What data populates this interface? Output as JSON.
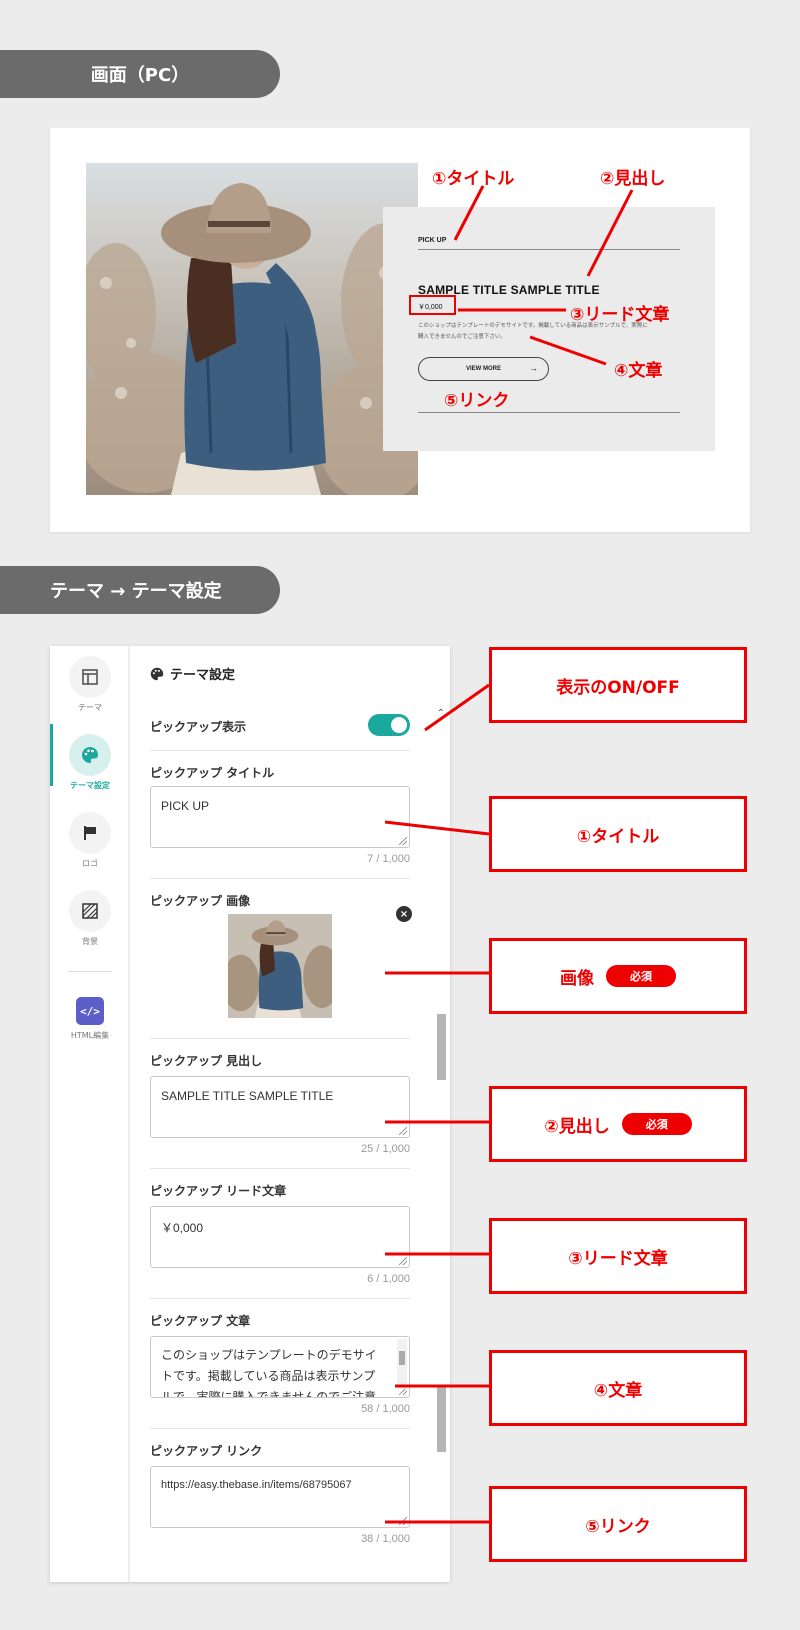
{
  "sections": {
    "pc_title": "画面（PC）",
    "settings_title": "テーマ → テーマ設定"
  },
  "pc_preview": {
    "pickup_title": "PICK UP",
    "heading": "SAMPLE TITLE SAMPLE TITLE",
    "price": "￥0,000",
    "text_line1": "このショップはテンプレートのデモサイトです。掲載している商品は表示サンプルで、実際に",
    "text_line2": "購入できませんのでご注意下さい。",
    "link_label": "VIEW MORE",
    "link_arrow": "→"
  },
  "pc_annotations": {
    "title": "①タイトル",
    "heading": "②見出し",
    "lead": "③リード文章",
    "text": "④文章",
    "link": "⑤リンク"
  },
  "sidebar": {
    "items": [
      {
        "label": "テーマ",
        "icon": "layout-icon"
      },
      {
        "label": "テーマ設定",
        "icon": "palette-icon"
      },
      {
        "label": "ロゴ",
        "icon": "flag-icon"
      },
      {
        "label": "背景",
        "icon": "pattern-icon"
      },
      {
        "label": "HTML編集",
        "icon": "code-icon",
        "icon_text": "</>"
      }
    ]
  },
  "panel": {
    "header": "テーマ設定",
    "toggle_label": "ピックアップ表示",
    "toggle_on": true,
    "fields": [
      {
        "label": "ピックアップ タイトル",
        "value": "PICK UP",
        "counter": "7 / 1,000"
      },
      {
        "label": "ピックアップ 見出し",
        "value": "SAMPLE TITLE SAMPLE TITLE",
        "counter": "25 / 1,000"
      },
      {
        "label": "ピックアップ リード文章",
        "value": "￥0,000",
        "counter": "6 / 1,000"
      },
      {
        "label": "ピックアップ 文章",
        "value": "このショップはテンプレートのデモサイトです。掲載している商品は表示サンプルで、実際に購入できませんのでご注意",
        "counter": "58 / 1,000"
      },
      {
        "label": "ピックアップ リンク",
        "value": "https://easy.thebase.in/items/68795067",
        "counter": "38 / 1,000"
      }
    ],
    "image_label": "ピックアップ 画像",
    "image_close": "×"
  },
  "annotations": {
    "toggle": "表示のON/OFF",
    "title": "①タイトル",
    "image": "画像",
    "image_badge": "必須",
    "heading": "②見出し",
    "heading_badge": "必須",
    "lead": "③リード文章",
    "text": "④文章",
    "link": "⑤リンク"
  },
  "colors": {
    "accent": "#1aa99c",
    "annotation_red": "#e00000",
    "tab_gray": "#6b6b6b",
    "html_icon": "#5b5fc7"
  }
}
